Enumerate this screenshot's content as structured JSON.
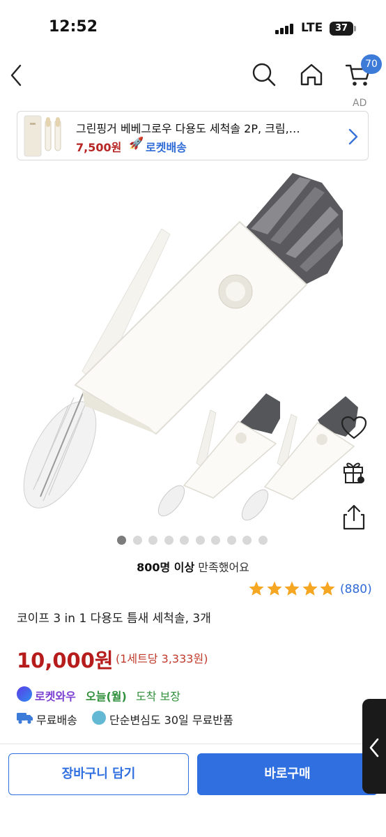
{
  "status_bar": {
    "time": "12:52",
    "network": "LTE",
    "battery": "37"
  },
  "nav": {
    "back_icon": "chevron-left-icon",
    "search_icon": "search-icon",
    "home_icon": "home-icon",
    "cart_icon": "cart-icon",
    "cart_count": "70"
  },
  "ad": {
    "label": "AD",
    "title": "그린핑거 베베그로우 다용도 세척솔 2P, 크림,…",
    "price": "7,500원",
    "delivery": "로켓배송"
  },
  "gallery": {
    "page_count": 10,
    "active_index": 0
  },
  "social_proof": {
    "highlight": "800명 이상",
    "suffix": " 만족했어요"
  },
  "rating": {
    "stars": 5,
    "review_count": "(880)"
  },
  "product": {
    "title": "코이프 3 in 1 다용도 틈새 세척솔, 3개",
    "price": "10,000원",
    "unit_price": "(1세트당 3,333원)"
  },
  "delivery": {
    "rocket_wow": "로켓와우",
    "today": "오늘(월)",
    "guarantee": "도착 보장",
    "free_shipping": "무료배송",
    "free_return": "단순변심도 30일 무료반품"
  },
  "actions": {
    "add_to_cart": "장바구니 담기",
    "buy_now": "바로구매"
  },
  "colors": {
    "accent": "#2f6fe0",
    "price_red": "#b71c1c",
    "star": "#f5a623",
    "green": "#2f8f3a"
  }
}
